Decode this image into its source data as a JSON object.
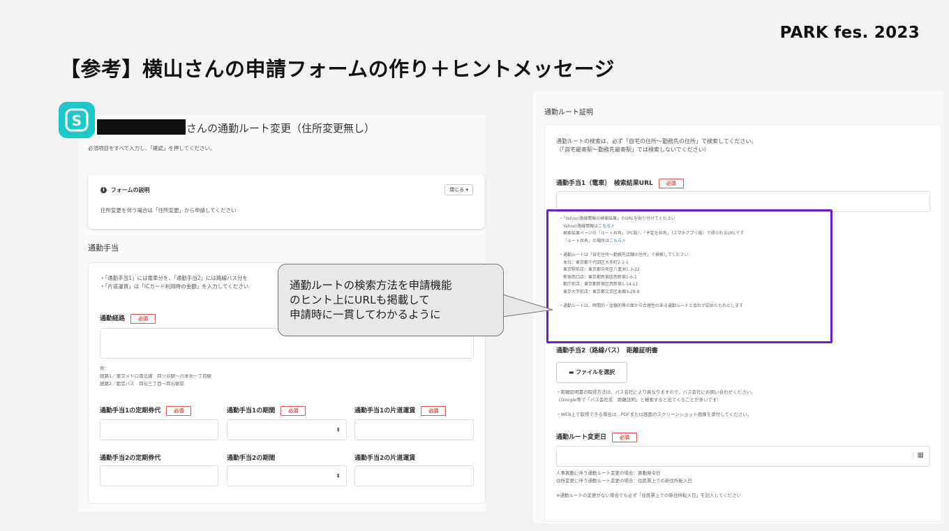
{
  "header": {
    "brand": "PARK fes. 2023",
    "title": "【参考】横山さんの申請フォームの作り＋ヒントメッセージ"
  },
  "left": {
    "form_title": "さんの通勤ルート変更（住所変更無し）",
    "instruction": "必須項目をすべて入力し、「確認」を押してください。",
    "description": {
      "title": "フォームの説明",
      "close_label": "閉じる",
      "body": "住所変更を伴う場合は「住所変更」から申請してください"
    },
    "section_title": "通勤手当",
    "notes": [
      "・「通勤手当1」には電車分を、「通勤手当2」には路線バス分を",
      "・「片道運賃」は「ICカード利用時の金額」を入力してください"
    ],
    "route_label": "通勤経路",
    "required_label": "必須",
    "example": [
      "例：",
      "経路1／東京メトロ南北線　四ツ谷駅〜六本木一丁目駅",
      "経路2／都営バス　四谷三丁目〜四谷駅前"
    ],
    "row1": [
      "通勤手当1の定期券代",
      "通勤手当1の期間",
      "通勤手当1の片道運賃"
    ],
    "row2": [
      "通勤手当2の定期券代",
      "通勤手当2の期間",
      "通勤手当2の片道運賃"
    ]
  },
  "callout": {
    "lines": [
      "通勤ルートの検索方法を申請機能",
      "のヒント上にURLも掲載して",
      "申請時に一貫してわかるように"
    ]
  },
  "right": {
    "section_title": "通勤ルート証明",
    "intro": [
      "通勤ルートの検索は、必ず「自宅の住所〜勤務先の住所」で検索してください。",
      "（「自宅最寄駅〜勤務先最寄駅」では検索しないでください）"
    ],
    "field1_label": "通勤手当1（電車）　検索結果URL",
    "hint": {
      "line1": "・「Yahoo!路線情報の検索結果」のURLを貼り付けてください",
      "line2_text": "Yahoo!路線情報は",
      "line2_link": "こちら",
      "line3": "検索結果ページの「ルート共有」（PC版）、「予定を共有」（スマホアプリ版）で得られるURLです",
      "line4_text": "「ルート共有」の場所は",
      "line4_link": "こちら",
      "line5": "・通勤ルートは「自宅住所〜勤務先店舗の住所」で検索してください",
      "addresses": [
        "本社：東京都千代田区大手町2-1-1",
        "東京駅前店：東京都中央区八重洲1-3-22",
        "新宿西口店：東京都新宿区西新宿1-6-1",
        "都庁前店：東京都新宿区西新宿1-14-11",
        "東京大学前店：東京都文京区本郷3-28-8"
      ],
      "line_last": "・通勤ルートは、時間的・金額的等の面から合理性のある通勤ルートと会社が認めたものとします"
    },
    "field2_label": "通勤手当2（路線バス）　距離証明書",
    "file_button": "ファイルを選択",
    "file_notes": [
      "・距離証明書の取得方法は、バス会社により異なりますので、バス会社にお問い合わせください。",
      "（Google等で「バス会社名　距離証明」と検索すると出てくることが多いです）",
      "・WEB上で取得できる場合は、PDFまたは画面のスクリーンショット画像を添付してください。"
    ],
    "date_label": "通勤ルート変更日",
    "date_notes": [
      "人事異動に伴う通勤ルート変更の場合：異動発令日",
      "住所変更に伴う通勤ルート変更の場合：住民票上での新住所転入日"
    ],
    "final_note": "※通勤ルートの変更がない場合でも必ず「住民票上での新住所転入日」を記入してください"
  },
  "colors": {
    "accent_purple": "#6a1fd6",
    "required_red": "#d9534f",
    "logo_teal": "#1ec8c8"
  }
}
